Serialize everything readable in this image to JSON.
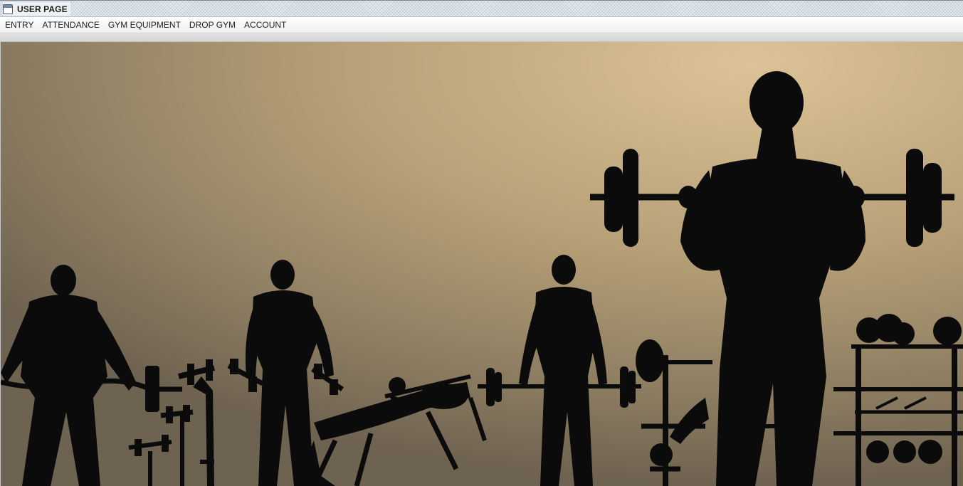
{
  "window": {
    "title": "USER PAGE",
    "icon": "window-icon"
  },
  "menu": {
    "items": [
      {
        "label": "ENTRY"
      },
      {
        "label": "ATTENDANCE"
      },
      {
        "label": "GYM EQUIPMENT"
      },
      {
        "label": "DROP GYM"
      },
      {
        "label": "ACCOUNT"
      }
    ]
  },
  "content": {
    "background_image": "gym-silhouette-illustration",
    "colors": {
      "background_light": "#d6bd90",
      "background_dark": "#6e6250",
      "silhouette": "#0b0b0b"
    }
  }
}
